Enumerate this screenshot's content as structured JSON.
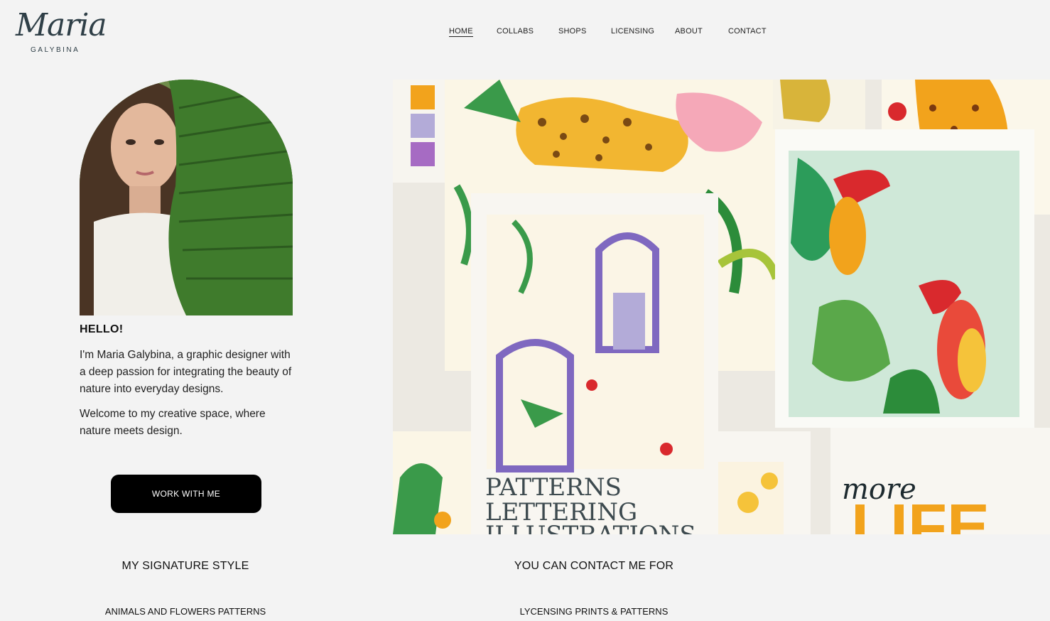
{
  "logo": {
    "script": "Maria",
    "subtitle": "GALYBINA"
  },
  "nav": {
    "items": [
      {
        "label": "HOME",
        "active": true
      },
      {
        "label": "COLLABS"
      },
      {
        "label": "SHOPS"
      },
      {
        "label": "LICENSING"
      },
      {
        "label": "ABOUT"
      },
      {
        "label": "CONTACT"
      }
    ]
  },
  "about": {
    "heading": "HELLO!",
    "paragraphs": [
      "I'm Maria Galybina, a graphic designer with a deep passion for integrating the beauty of nature into everyday designs.",
      "Welcome to my creative space, where nature meets design."
    ],
    "cta_label": "WORK WITH ME"
  },
  "collage": {
    "poster_lines": [
      "PATTERNS",
      "LETTERING",
      "ILLUSTRATIONS"
    ],
    "card_lettering": [
      "more",
      "LIFE"
    ]
  },
  "sections": {
    "signature": {
      "title": "MY SIGNATURE STYLE",
      "items": [
        "ANIMALS AND FLOWERS PATTERNS"
      ]
    },
    "contact": {
      "title": "YOU CAN CONTACT ME FOR",
      "items": [
        "LYCENSING PRINTS & PATTERNS"
      ]
    }
  },
  "colors": {
    "background": "#f3f3f3",
    "button": "#000000",
    "logo": "#2f3f47",
    "leopard": "#f2b631",
    "lavender": "#8f86c9",
    "leaf_green": "#3a9a4a"
  }
}
